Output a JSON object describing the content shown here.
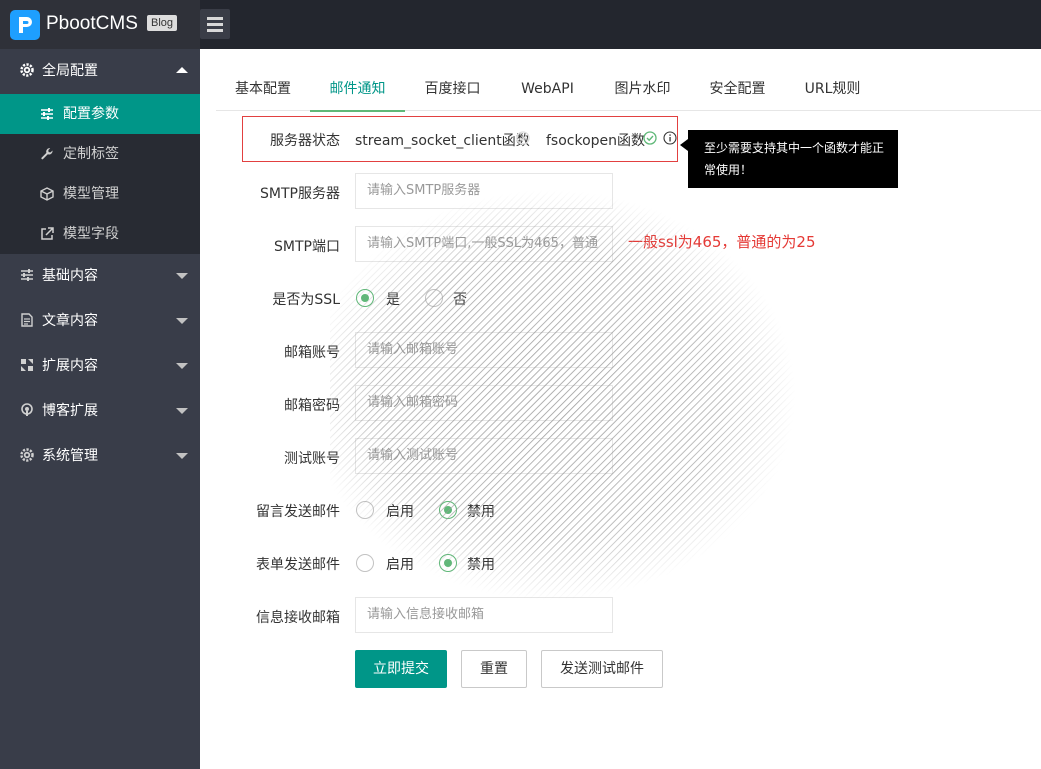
{
  "app": {
    "name": "PbootCMS",
    "badge": "Blog"
  },
  "sidebar": {
    "groups": [
      {
        "label": "全局配置",
        "icon": "gear-icon",
        "expanded": true,
        "items": [
          {
            "label": "配置参数",
            "icon": "sliders-icon",
            "active": true
          },
          {
            "label": "定制标签",
            "icon": "wrench-icon"
          },
          {
            "label": "模型管理",
            "icon": "cube-icon"
          },
          {
            "label": "模型字段",
            "icon": "external-link-icon"
          }
        ]
      },
      {
        "label": "基础内容",
        "icon": "sliders-icon"
      },
      {
        "label": "文章内容",
        "icon": "document-icon"
      },
      {
        "label": "扩展内容",
        "icon": "expand-icon"
      },
      {
        "label": "博客扩展",
        "icon": "podcast-icon"
      },
      {
        "label": "系统管理",
        "icon": "gear-icon"
      }
    ]
  },
  "tabs": [
    "基本配置",
    "邮件通知",
    "百度接口",
    "WebAPI",
    "图片水印",
    "安全配置",
    "URL规则"
  ],
  "active_tab": "邮件通知",
  "form": {
    "server_status": {
      "label": "服务器状态",
      "func1": "stream_socket_client函数",
      "func2": "fsockopen函数",
      "tooltip": "至少需要支持其中一个函数才能正常使用！"
    },
    "smtp_server": {
      "label": "SMTP服务器",
      "placeholder": "请输入SMTP服务器"
    },
    "smtp_port": {
      "label": "SMTP端口",
      "placeholder": "请输入SMTP端口,一般SSL为465，普通",
      "note": "一般ssl为465，普通的为25"
    },
    "ssl": {
      "label": "是否为SSL",
      "yes": "是",
      "no": "否",
      "selected": "是"
    },
    "email_account": {
      "label": "邮箱账号",
      "placeholder": "请输入邮箱账号"
    },
    "email_password": {
      "label": "邮箱密码",
      "placeholder": "请输入邮箱密码"
    },
    "test_account": {
      "label": "测试账号",
      "placeholder": "请输入测试账号"
    },
    "message_mail": {
      "label": "留言发送邮件",
      "enable": "启用",
      "disable": "禁用",
      "selected": "禁用"
    },
    "form_mail": {
      "label": "表单发送邮件",
      "enable": "启用",
      "disable": "禁用",
      "selected": "禁用"
    },
    "receive_mail": {
      "label": "信息接收邮箱",
      "placeholder": "请输入信息接收邮箱"
    }
  },
  "buttons": {
    "submit": "立即提交",
    "reset": "重置",
    "send_test": "发送测试邮件"
  },
  "colors": {
    "accent": "#009688",
    "sidebar": "#393d49",
    "header": "#23262e",
    "annotation": "#e53935",
    "check": "#5fb878"
  }
}
